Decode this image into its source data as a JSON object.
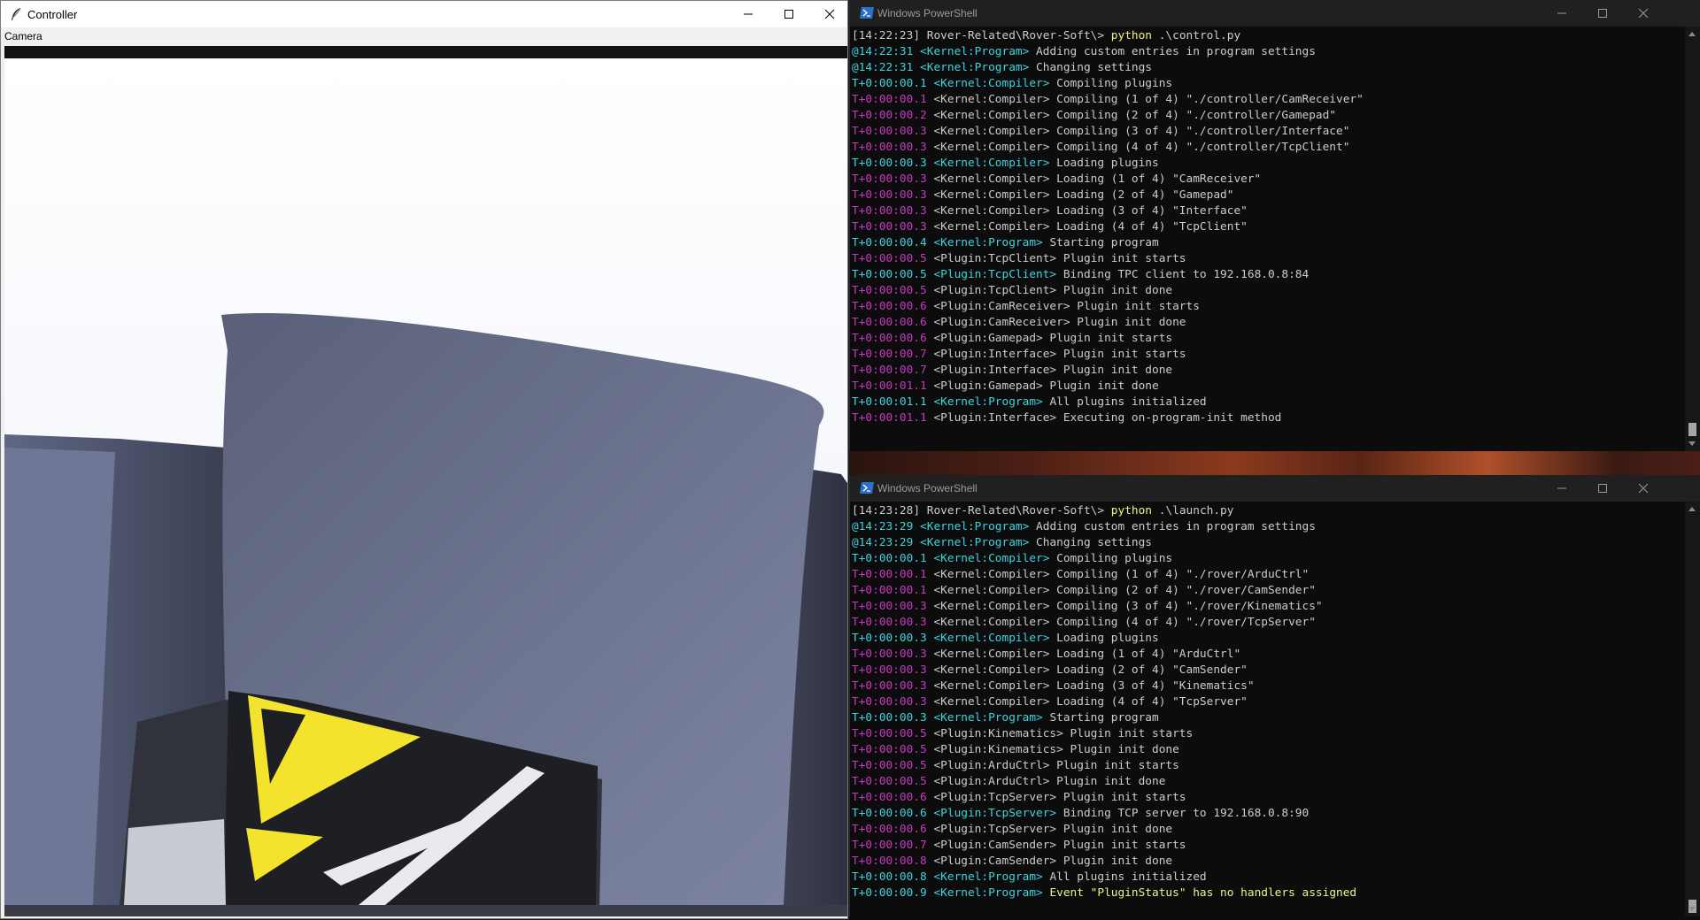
{
  "controller": {
    "title": "Controller",
    "menu": [
      "Camera"
    ]
  },
  "ps_top": {
    "title": "Windows PowerShell",
    "lines": [
      [
        {
          "c": "c-gray",
          "t": "[14:22:23] Rover-Related\\Rover-Soft\\> "
        },
        {
          "c": "c-yellow",
          "t": "python"
        },
        {
          "c": "c-gray",
          "t": " .\\control.py"
        }
      ],
      [
        {
          "c": "c-cyan",
          "t": "@14:22:31 <Kernel:Program>"
        },
        {
          "c": "c-gray",
          "t": " Adding custom entries in program settings"
        }
      ],
      [
        {
          "c": "c-cyan",
          "t": "@14:22:31 <Kernel:Program>"
        },
        {
          "c": "c-gray",
          "t": " Changing settings"
        }
      ],
      [
        {
          "c": "c-cyan",
          "t": "T+0:00:00.1 <Kernel:Compiler>"
        },
        {
          "c": "c-gray",
          "t": " Compiling plugins"
        }
      ],
      [
        {
          "c": "c-mag",
          "t": "T+0:00:00.1"
        },
        {
          "c": "c-gray",
          "t": " <Kernel:Compiler> Compiling (1 of 4) \"./controller/CamReceiver\""
        }
      ],
      [
        {
          "c": "c-mag",
          "t": "T+0:00:00.2"
        },
        {
          "c": "c-gray",
          "t": " <Kernel:Compiler> Compiling (2 of 4) \"./controller/Gamepad\""
        }
      ],
      [
        {
          "c": "c-mag",
          "t": "T+0:00:00.3"
        },
        {
          "c": "c-gray",
          "t": " <Kernel:Compiler> Compiling (3 of 4) \"./controller/Interface\""
        }
      ],
      [
        {
          "c": "c-mag",
          "t": "T+0:00:00.3"
        },
        {
          "c": "c-gray",
          "t": " <Kernel:Compiler> Compiling (4 of 4) \"./controller/TcpClient\""
        }
      ],
      [
        {
          "c": "c-cyan",
          "t": "T+0:00:00.3 <Kernel:Compiler>"
        },
        {
          "c": "c-gray",
          "t": " Loading plugins"
        }
      ],
      [
        {
          "c": "c-mag",
          "t": "T+0:00:00.3"
        },
        {
          "c": "c-gray",
          "t": " <Kernel:Compiler> Loading (1 of 4) \"CamReceiver\""
        }
      ],
      [
        {
          "c": "c-mag",
          "t": "T+0:00:00.3"
        },
        {
          "c": "c-gray",
          "t": " <Kernel:Compiler> Loading (2 of 4) \"Gamepad\""
        }
      ],
      [
        {
          "c": "c-mag",
          "t": "T+0:00:00.3"
        },
        {
          "c": "c-gray",
          "t": " <Kernel:Compiler> Loading (3 of 4) \"Interface\""
        }
      ],
      [
        {
          "c": "c-mag",
          "t": "T+0:00:00.3"
        },
        {
          "c": "c-gray",
          "t": " <Kernel:Compiler> Loading (4 of 4) \"TcpClient\""
        }
      ],
      [
        {
          "c": "c-cyan",
          "t": "T+0:00:00.4 <Kernel:Program>"
        },
        {
          "c": "c-gray",
          "t": " Starting program"
        }
      ],
      [
        {
          "c": "c-mag",
          "t": "T+0:00:00.5"
        },
        {
          "c": "c-gray",
          "t": " <Plugin:TcpClient> Plugin init starts"
        }
      ],
      [
        {
          "c": "c-cyan",
          "t": "T+0:00:00.5 <Plugin:TcpClient>"
        },
        {
          "c": "c-gray",
          "t": " Binding TPC client to 192.168.0.8:84"
        }
      ],
      [
        {
          "c": "c-mag",
          "t": "T+0:00:00.5"
        },
        {
          "c": "c-gray",
          "t": " <Plugin:TcpClient> Plugin init done"
        }
      ],
      [
        {
          "c": "c-mag",
          "t": "T+0:00:00.6"
        },
        {
          "c": "c-gray",
          "t": " <Plugin:CamReceiver> Plugin init starts"
        }
      ],
      [
        {
          "c": "c-mag",
          "t": "T+0:00:00.6"
        },
        {
          "c": "c-gray",
          "t": " <Plugin:CamReceiver> Plugin init done"
        }
      ],
      [
        {
          "c": "c-mag",
          "t": "T+0:00:00.6"
        },
        {
          "c": "c-gray",
          "t": " <Plugin:Gamepad> Plugin init starts"
        }
      ],
      [
        {
          "c": "c-mag",
          "t": "T+0:00:00.7"
        },
        {
          "c": "c-gray",
          "t": " <Plugin:Interface> Plugin init starts"
        }
      ],
      [
        {
          "c": "c-mag",
          "t": "T+0:00:00.7"
        },
        {
          "c": "c-gray",
          "t": " <Plugin:Interface> Plugin init done"
        }
      ],
      [
        {
          "c": "c-mag",
          "t": "T+0:00:01.1"
        },
        {
          "c": "c-gray",
          "t": " <Plugin:Gamepad> Plugin init done"
        }
      ],
      [
        {
          "c": "c-cyan",
          "t": "T+0:00:01.1 <Kernel:Program>"
        },
        {
          "c": "c-gray",
          "t": " All plugins initialized"
        }
      ],
      [
        {
          "c": "c-mag",
          "t": "T+0:00:01.1"
        },
        {
          "c": "c-gray",
          "t": " <Plugin:Interface> Executing on-program-init method"
        }
      ]
    ]
  },
  "ps_bottom": {
    "title": "Windows PowerShell",
    "lines": [
      [
        {
          "c": "c-gray",
          "t": "[14:23:28] Rover-Related\\Rover-Soft\\> "
        },
        {
          "c": "c-yellow",
          "t": "python"
        },
        {
          "c": "c-gray",
          "t": " .\\launch.py"
        }
      ],
      [
        {
          "c": "c-cyan",
          "t": "@14:23:29 <Kernel:Program>"
        },
        {
          "c": "c-gray",
          "t": " Adding custom entries in program settings"
        }
      ],
      [
        {
          "c": "c-cyan",
          "t": "@14:23:29 <Kernel:Program>"
        },
        {
          "c": "c-gray",
          "t": " Changing settings"
        }
      ],
      [
        {
          "c": "c-cyan",
          "t": "T+0:00:00.1 <Kernel:Compiler>"
        },
        {
          "c": "c-gray",
          "t": " Compiling plugins"
        }
      ],
      [
        {
          "c": "c-mag",
          "t": "T+0:00:00.1"
        },
        {
          "c": "c-gray",
          "t": " <Kernel:Compiler> Compiling (1 of 4) \"./rover/ArduCtrl\""
        }
      ],
      [
        {
          "c": "c-mag",
          "t": "T+0:00:00.1"
        },
        {
          "c": "c-gray",
          "t": " <Kernel:Compiler> Compiling (2 of 4) \"./rover/CamSender\""
        }
      ],
      [
        {
          "c": "c-mag",
          "t": "T+0:00:00.3"
        },
        {
          "c": "c-gray",
          "t": " <Kernel:Compiler> Compiling (3 of 4) \"./rover/Kinematics\""
        }
      ],
      [
        {
          "c": "c-mag",
          "t": "T+0:00:00.3"
        },
        {
          "c": "c-gray",
          "t": " <Kernel:Compiler> Compiling (4 of 4) \"./rover/TcpServer\""
        }
      ],
      [
        {
          "c": "c-cyan",
          "t": "T+0:00:00.3 <Kernel:Compiler>"
        },
        {
          "c": "c-gray",
          "t": " Loading plugins"
        }
      ],
      [
        {
          "c": "c-mag",
          "t": "T+0:00:00.3"
        },
        {
          "c": "c-gray",
          "t": " <Kernel:Compiler> Loading (1 of 4) \"ArduCtrl\""
        }
      ],
      [
        {
          "c": "c-mag",
          "t": "T+0:00:00.3"
        },
        {
          "c": "c-gray",
          "t": " <Kernel:Compiler> Loading (2 of 4) \"CamSender\""
        }
      ],
      [
        {
          "c": "c-mag",
          "t": "T+0:00:00.3"
        },
        {
          "c": "c-gray",
          "t": " <Kernel:Compiler> Loading (3 of 4) \"Kinematics\""
        }
      ],
      [
        {
          "c": "c-mag",
          "t": "T+0:00:00.3"
        },
        {
          "c": "c-gray",
          "t": " <Kernel:Compiler> Loading (4 of 4) \"TcpServer\""
        }
      ],
      [
        {
          "c": "c-cyan",
          "t": "T+0:00:00.3 <Kernel:Program>"
        },
        {
          "c": "c-gray",
          "t": " Starting program"
        }
      ],
      [
        {
          "c": "c-mag",
          "t": "T+0:00:00.5"
        },
        {
          "c": "c-gray",
          "t": " <Plugin:Kinematics> Plugin init starts"
        }
      ],
      [
        {
          "c": "c-mag",
          "t": "T+0:00:00.5"
        },
        {
          "c": "c-gray",
          "t": " <Plugin:Kinematics> Plugin init done"
        }
      ],
      [
        {
          "c": "c-mag",
          "t": "T+0:00:00.5"
        },
        {
          "c": "c-gray",
          "t": " <Plugin:ArduCtrl> Plugin init starts"
        }
      ],
      [
        {
          "c": "c-mag",
          "t": "T+0:00:00.5"
        },
        {
          "c": "c-gray",
          "t": " <Plugin:ArduCtrl> Plugin init done"
        }
      ],
      [
        {
          "c": "c-mag",
          "t": "T+0:00:00.6"
        },
        {
          "c": "c-gray",
          "t": " <Plugin:TcpServer> Plugin init starts"
        }
      ],
      [
        {
          "c": "c-cyan",
          "t": "T+0:00:00.6 <Plugin:TcpServer>"
        },
        {
          "c": "c-gray",
          "t": " Binding TCP server to 192.168.0.8:90"
        }
      ],
      [
        {
          "c": "c-mag",
          "t": "T+0:00:00.6"
        },
        {
          "c": "c-gray",
          "t": " <Plugin:TcpServer> Plugin init done"
        }
      ],
      [
        {
          "c": "c-mag",
          "t": "T+0:00:00.7"
        },
        {
          "c": "c-gray",
          "t": " <Plugin:CamSender> Plugin init starts"
        }
      ],
      [
        {
          "c": "c-mag",
          "t": "T+0:00:00.8"
        },
        {
          "c": "c-gray",
          "t": " <Plugin:CamSender> Plugin init done"
        }
      ],
      [
        {
          "c": "c-cyan",
          "t": "T+0:00:00.8 <Kernel:Program>"
        },
        {
          "c": "c-gray",
          "t": " All plugins initialized"
        }
      ],
      [
        {
          "c": "c-cyan",
          "t": "T+0:00:00.9 <Kernel:Program>"
        },
        {
          "c": "c-yellow",
          "t": " Event \"PluginStatus\" has no handlers assigned"
        }
      ]
    ]
  }
}
